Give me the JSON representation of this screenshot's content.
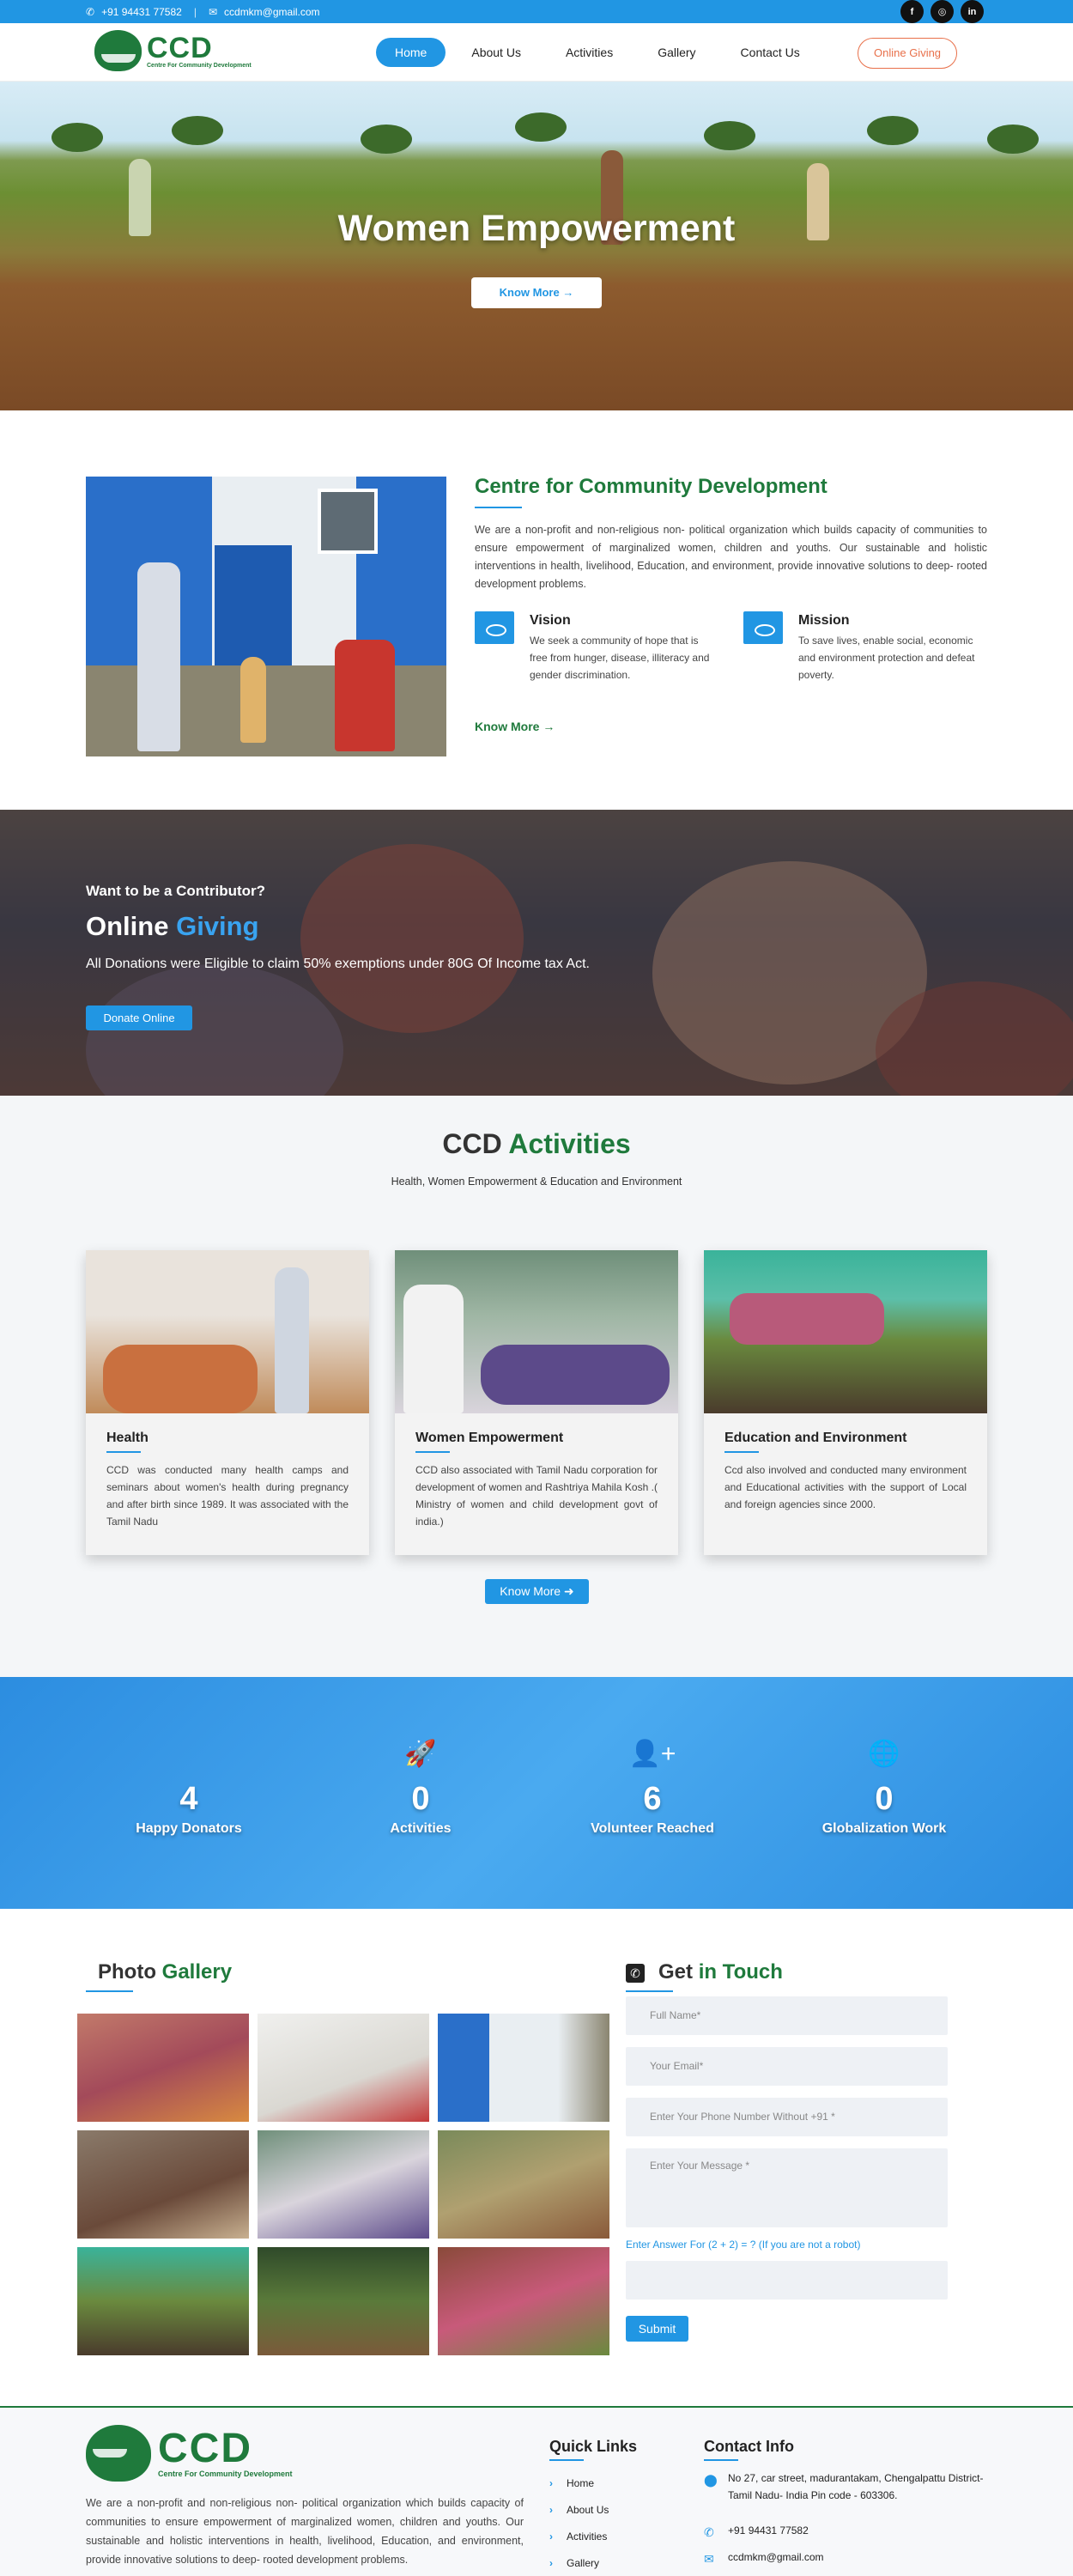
{
  "topbar": {
    "phone": "+91 94431 77582",
    "email": "ccdmkm@gmail.com",
    "socials": [
      "facebook-icon",
      "instagram-icon",
      "linkedin-icon"
    ]
  },
  "brand": {
    "name": "CCD",
    "tagline": "Centre For Community Development"
  },
  "nav": {
    "items": [
      "Home",
      "About Us",
      "Activities",
      "Gallery",
      "Contact Us"
    ],
    "active": "Home",
    "cta": "Online Giving"
  },
  "hero": {
    "title": "Women Empowerment",
    "button": "Know More →"
  },
  "about": {
    "title": "Centre for Community Development",
    "text": "We are a non-profit and non-religious non- political organization which builds capacity of communities to ensure empowerment of marginalized women, children and youths. Our sustainable and holistic interventions in health, livelihood, Education, and environment, provide innovative solutions to deep- rooted development problems.",
    "vision": {
      "title": "Vision",
      "text": "We seek a community of hope that is free from hunger, disease, illiteracy and gender discrimination."
    },
    "mission": {
      "title": "Mission",
      "text": "To save lives, enable social, economic and environment protection and defeat poverty."
    },
    "more": "Know More →"
  },
  "donate": {
    "kicker": "Want to be a Contributor?",
    "title_a": "Online",
    "title_b": "Giving",
    "note": "All Donations were Eligible to claim 50% exemptions under 80G Of Income tax Act.",
    "button": "Donate Online"
  },
  "activities": {
    "title_a": "CCD",
    "title_b": "Activities",
    "subtitle": "Health, Women Empowerment & Education and Environment",
    "cards": [
      {
        "title": "Health",
        "text": "CCD was conducted many health camps and seminars about women's health during pregnancy and after birth since 1989. It was associated with the Tamil Nadu"
      },
      {
        "title": "Women Empowerment",
        "text": "CCD also associated with Tamil Nadu corporation for development of women and Rashtriya Mahila Kosh .( Ministry of women and child development govt of india.)"
      },
      {
        "title": "Education and Environment",
        "text": "Ccd also involved and conducted many environment and Educational activities with the support of Local and foreign agencies since 2000."
      }
    ],
    "button": "Know More"
  },
  "stats": [
    {
      "icon": "handshake-icon",
      "value": "4",
      "label": "Happy Donators"
    },
    {
      "icon": "rocket-icon",
      "value": "0",
      "label": "Activities"
    },
    {
      "icon": "add-user-icon",
      "value": "6",
      "label": "Volunteer Reached"
    },
    {
      "icon": "globe-icon",
      "value": "0",
      "label": "Globalization Work"
    }
  ],
  "gallery": {
    "title_a": "Photo",
    "title_b": "Gallery"
  },
  "contact": {
    "title_a": "Get",
    "title_b": "in Touch",
    "placeholders": {
      "name": "Full Name*",
      "email": "Your Email*",
      "phone": "Enter Your Phone Number Without +91 *",
      "message": "Enter Your Message *"
    },
    "captcha": "Enter Answer For (2 + 2) = ? (If you are not a robot)",
    "submit": "Submit"
  },
  "footer": {
    "text": "We are a non-profit and non-religious non- political organization which builds capacity of communities to ensure empowerment of marginalized women, children and youths. Our sustainable and holistic interventions in health, livelihood, Education, and environment, provide innovative solutions to deep- rooted development problems.",
    "quick_title": "Quick Links",
    "quick_links": [
      "Home",
      "About Us",
      "Activities",
      "Gallery"
    ],
    "contact_title": "Contact Info",
    "address": "No 27, car street, madurantakam, Chengalpattu District- Tamil Nadu- India Pin code - 603306.",
    "phone": "+91 94431 77582",
    "email": "ccdmkm@gmail.com"
  },
  "colors": {
    "primary": "#2196e3",
    "brand_green": "#1f7a3c",
    "accent_orange": "#e8704a"
  }
}
